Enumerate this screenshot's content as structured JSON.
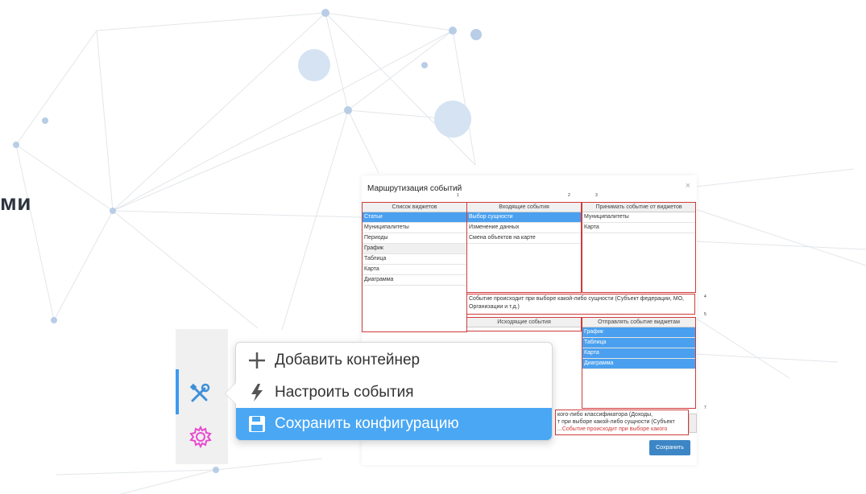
{
  "partial_title": "ми",
  "dialog": {
    "title": "Маршрутизация событий",
    "close": "×",
    "widgets": {
      "number": "1",
      "header": "Список виджетов",
      "rows": [
        "Статьи",
        "Муниципалитеты",
        "Периоды",
        "График",
        "Таблица",
        "Карта",
        "Диаграмма"
      ]
    },
    "incoming": {
      "number": "2",
      "header": "Входящие события",
      "rows": [
        "Выбор сущности",
        "Изменение данных",
        "Смена объектов на карте"
      ]
    },
    "accept": {
      "number": "3",
      "header": "Принимать событие от виджетов",
      "rows": [
        "Муниципалитеты",
        "Карта"
      ]
    },
    "desc1": {
      "number": "4",
      "text": "Событие происходит при выборе какой-либо сущности (Субъект федерации, МО, Организации и т.д.)"
    },
    "outgoing": {
      "header": "Исходящие события"
    },
    "send": {
      "number": "5",
      "header": "Отправлять событие виджетам",
      "rows": [
        "График",
        "Таблица",
        "Карта",
        "Диаграмма"
      ]
    },
    "desc2": {
      "number": "7",
      "line1": "кого-либо классификатора (Доходы,",
      "line2": "т при выборе какой-либо сущности (Субъект",
      "line3": "...Событие происходит при выборе какого"
    },
    "save_button": "Сохранить"
  },
  "menu": {
    "items": [
      {
        "label": "Добавить контейнер",
        "icon": "plus-icon"
      },
      {
        "label": "Настроить события",
        "icon": "lightning-icon"
      },
      {
        "label": "Сохранить конфигурацию",
        "icon": "floppy-icon"
      }
    ]
  },
  "toolbar": {
    "icons": [
      "tools-icon",
      "gear-icon"
    ]
  },
  "colors": {
    "accent": "#4aa7f3",
    "dialog_border": "#d03a3a",
    "selected_row": "#4aa0ef",
    "save_button": "#3d86c6",
    "toolbar_bg": "#f0f0f0"
  }
}
